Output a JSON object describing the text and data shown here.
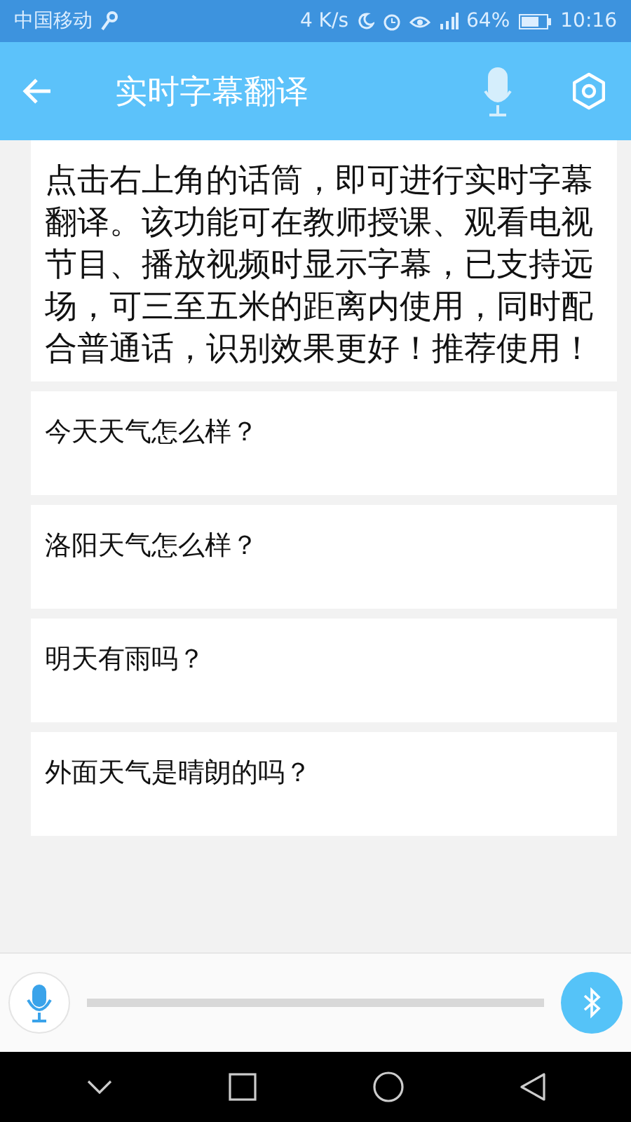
{
  "status_bar": {
    "carrier": "中国移动",
    "speed": "4 K/s",
    "battery": "64%",
    "time": "10:16"
  },
  "app_bar": {
    "title": "实时字幕翻译"
  },
  "intro": "点击右上角的话筒，即可进行实时字幕翻译。该功能可在教师授课、观看电视节目、播放视频时显示字幕，已支持远场，可三至五米的距离内使用，同时配合普通话，识别效果更好！推荐使用！",
  "messages": [
    "今天天气怎么样？",
    "洛阳天气怎么样？",
    "明天有雨吗？",
    "外面天气是晴朗的吗？"
  ]
}
